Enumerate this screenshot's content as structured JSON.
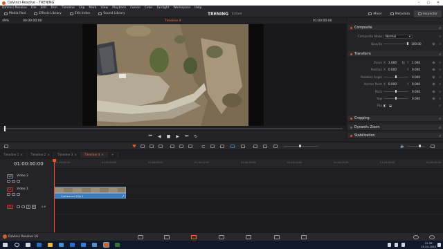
{
  "window": {
    "title": "DaVinci Resolve - TRENING"
  },
  "menu": [
    "DaVinci Resolve",
    "File",
    "Edit",
    "Trim",
    "Timeline",
    "Clip",
    "Mark",
    "View",
    "Playback",
    "Fusion",
    "Color",
    "Fairlight",
    "Workspace",
    "Help"
  ],
  "toolbar": {
    "media_pool": "Media Pool",
    "effects_library": "Effects Library",
    "edit_index": "Edit Index",
    "sound_library": "Sound Library",
    "project_name": "TRENING",
    "project_status": "Edited",
    "mixer": "Mixer",
    "metadata": "Metadata",
    "inspector": "Inspector"
  },
  "viewer": {
    "zoom": "49%",
    "timecode_left": "00:00:00:00",
    "timeline_name": "Timeline 4",
    "timecode_right": "01:00:00:00"
  },
  "inspector": {
    "composite": {
      "title": "Composite",
      "mode_label": "Composite Mode",
      "mode_value": "Normal",
      "opacity_label": "Opacity",
      "opacity_value": "100.00"
    },
    "transform": {
      "title": "Transform",
      "zoom_label": "Zoom",
      "zoom_x": "1.000",
      "zoom_y": "1.000",
      "position_label": "Position",
      "position_x": "0.000",
      "position_y": "0.000",
      "rotation_label": "Rotation Angle",
      "rotation_value": "0.000",
      "anchor_label": "Anchor Point",
      "anchor_x": "0.000",
      "anchor_y": "0.000",
      "pitch_label": "Pitch",
      "pitch_value": "0.000",
      "yaw_label": "Yaw",
      "yaw_value": "0.000",
      "flip_label": "Flip",
      "x_key": "X",
      "y_key": "Y"
    },
    "cropping": "Cropping",
    "dynamic_zoom": "Dynamic Zoom",
    "stabilization": "Stabilization"
  },
  "timeline": {
    "tabs": [
      "Timeline 1",
      "Timeline 2",
      "Timeline 3",
      "Timeline 4"
    ],
    "active_tab": 3,
    "timecode": "01:00:00:00",
    "ruler": [
      "01:00:00:00",
      "01:00:04:00",
      "01:00:08:00",
      "01:00:12:00",
      "01:00:16:00",
      "01:00:20:00",
      "01:00:24:00",
      "01:00:28:00",
      "01:00:32:00"
    ],
    "tracks": {
      "v2_id": "V2",
      "v2_name": "Video 2",
      "v1_id": "V1",
      "v1_name": "Video 1",
      "a1_id": "A1",
      "a1_s": "S",
      "a1_m": "M",
      "a1_ch": "2.0"
    },
    "clip_name": "Compound Clip 1"
  },
  "app": {
    "name": "DaVinci Resolve 16"
  },
  "clock": {
    "time": "12:36",
    "date": "25.05.2020"
  },
  "colors": {
    "accent": "#ff6a3d",
    "clip_video": "#5c6f85",
    "clip_audio": "#3d7ab8",
    "section_dot": "#e4522f"
  }
}
